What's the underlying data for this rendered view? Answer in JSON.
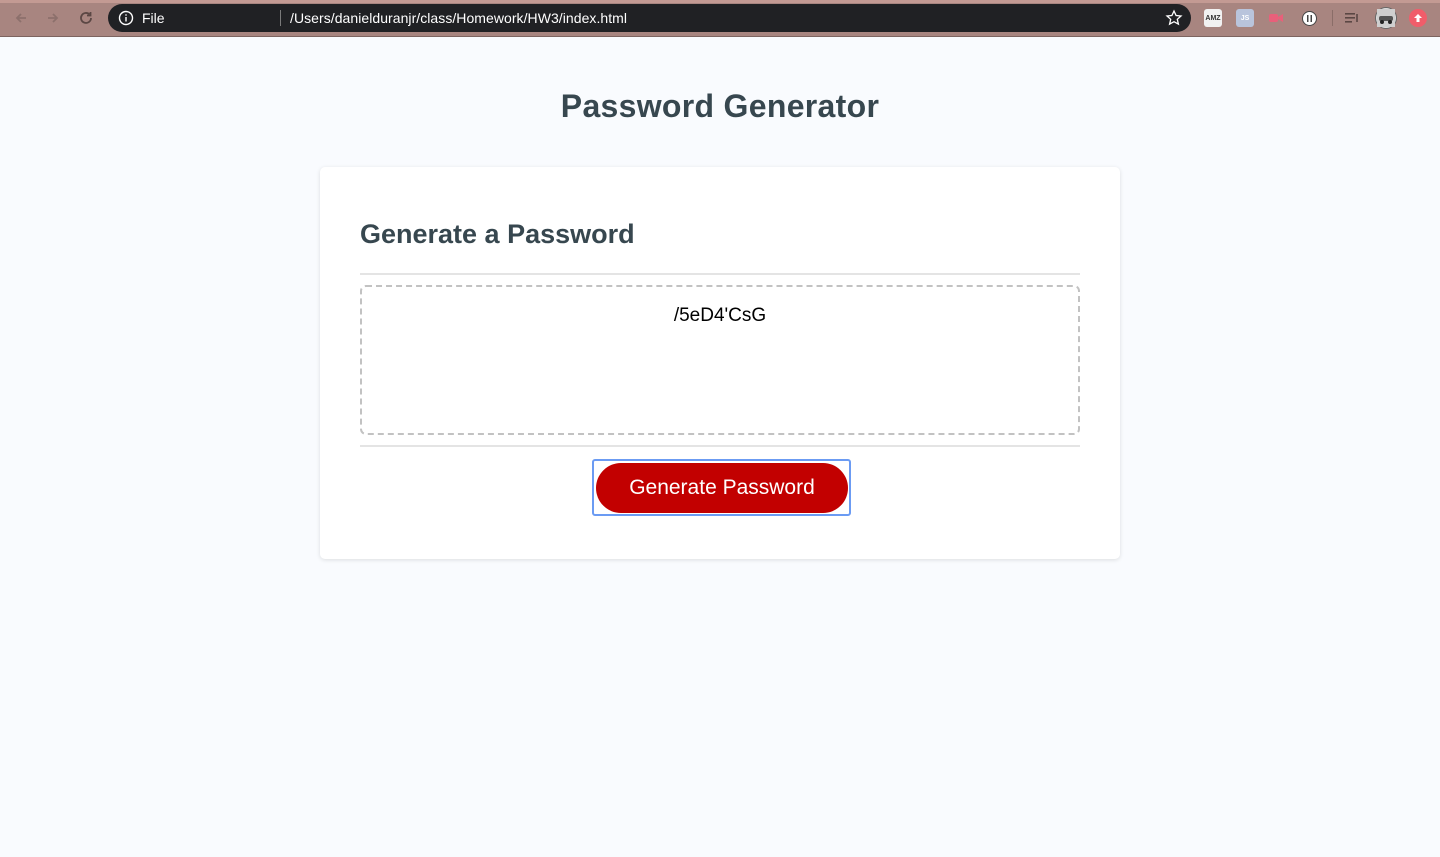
{
  "browser": {
    "file_label": "File",
    "url": "/Users/danielduranjr/class/Homework/HW3/index.html",
    "extensions": [
      "AMZ",
      "JS"
    ]
  },
  "page": {
    "title": "Password Generator",
    "card_title": "Generate a Password",
    "password": "/5eD4'CsG",
    "button_label": "Generate Password"
  },
  "colors": {
    "accent_button": "#c20000",
    "heading": "#37474f",
    "focus_ring": "#6b9bf3",
    "browser_frame": "#a88580"
  }
}
